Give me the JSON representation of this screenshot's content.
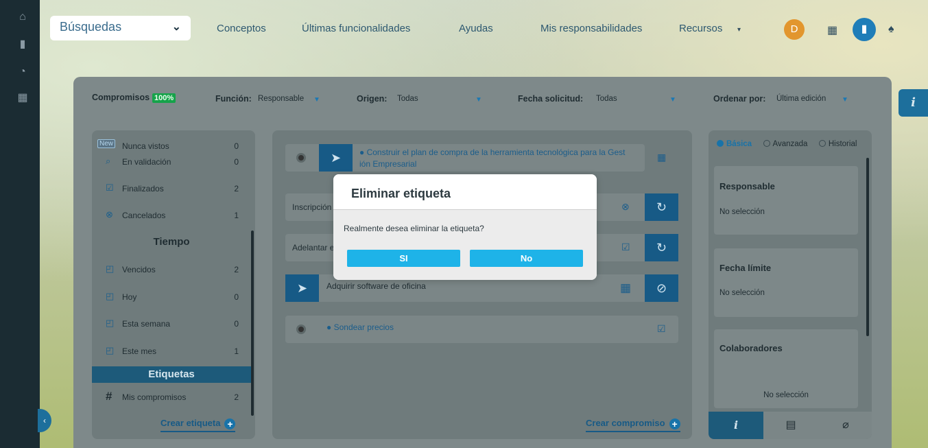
{
  "topbar": {
    "search_label": "Búsquedas",
    "nav": [
      "Conceptos",
      "Últimas funcionalidades",
      "Ayudas",
      "Mis responsabilidades",
      "Recursos"
    ],
    "avatar_initial": "D"
  },
  "filters": {
    "compromisos_label": "Compromisos",
    "compromisos_pct": "100%",
    "funcion_label": "Función:",
    "funcion_value": "Responsable",
    "origen_label": "Origen:",
    "origen_value": "Todas",
    "fecha_label": "Fecha solicitud:",
    "fecha_value": "Todas",
    "ordenar_label": "Ordenar por:",
    "ordenar_value": "Última edición"
  },
  "sidebar": {
    "new_badge": "New",
    "items_top": [
      {
        "label": "Nunca vistos",
        "count": "0"
      },
      {
        "label": "En validación",
        "count": "0"
      },
      {
        "label": "Finalizados",
        "count": "2"
      },
      {
        "label": "Cancelados",
        "count": "1"
      }
    ],
    "tiempo_header": "Tiempo",
    "items_tiempo": [
      {
        "label": "Vencidos",
        "count": "2"
      },
      {
        "label": "Hoy",
        "count": "0"
      },
      {
        "label": "Esta semana",
        "count": "0"
      },
      {
        "label": "Este mes",
        "count": "1"
      }
    ],
    "etiquetas_header": "Etiquetas",
    "tag_item": {
      "label": "Mis compromisos",
      "count": "2"
    },
    "create_tag": "Crear etiqueta"
  },
  "tasks": {
    "t1_line1": "Construir el plan de compra de la herramienta tecnológica para la Gest",
    "t1_line2": "ión Empresarial",
    "t2": "Inscripción",
    "t3": "Adelantar el estudio de los requisitos para el curso",
    "t4": "Adquirir software de oficina",
    "t5": "Sondear precios",
    "create": "Crear compromiso"
  },
  "right": {
    "radio_basica": "Básica",
    "radio_avanzada": "Avanzada",
    "radio_historial": "Historial",
    "responsable_label": "Responsable",
    "responsable_value": "No selección",
    "fecha_label": "Fecha límite",
    "fecha_value": "No selección",
    "colab_label": "Colaboradores",
    "colab_value": "No selección",
    "tab_info": "i"
  },
  "modal": {
    "title": "Eliminar etiqueta",
    "question": "Realmente desea eliminar la etiqueta?",
    "yes": "SI",
    "no": "No"
  }
}
